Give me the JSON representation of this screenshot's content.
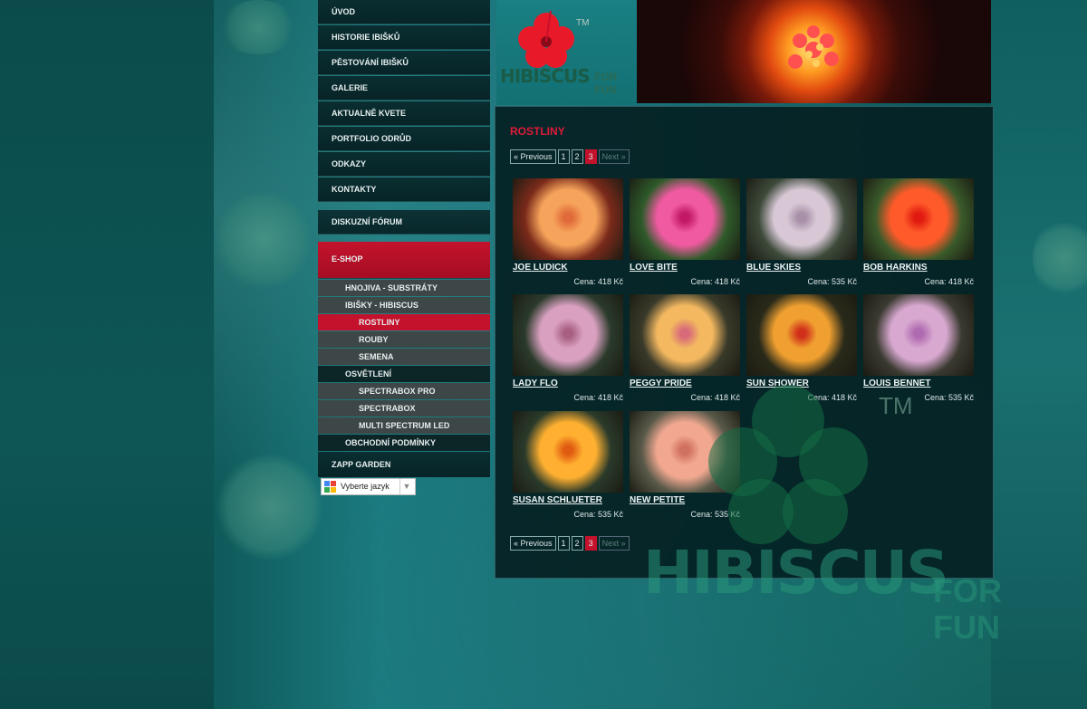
{
  "nav": {
    "items": [
      "ÚVOD",
      "HISTORIE IBIŠKŮ",
      "PĚSTOVÁNÍ IBIŠKŮ",
      "GALERIE",
      "AKTUALNĚ KVETE",
      "PORTFOLIO ODRŮD",
      "ODKAZY",
      "KONTAKTY"
    ],
    "forum": "DISKUZNÍ FÓRUM",
    "eshop": "E-SHOP",
    "sub": [
      {
        "label": "HNOJIVA - SUBSTRÁTY",
        "level": 1,
        "style": "grey"
      },
      {
        "label": "IBIŠKY - HIBISCUS",
        "level": 1,
        "style": "grey"
      },
      {
        "label": "ROSTLINY",
        "level": 2,
        "style": "active"
      },
      {
        "label": "ROUBY",
        "level": 2,
        "style": "grey"
      },
      {
        "label": "SEMENA",
        "level": 2,
        "style": "grey"
      },
      {
        "label": "OSVĚTLENÍ",
        "level": 1,
        "style": "dark"
      },
      {
        "label": "SPECTRABOX PRO",
        "level": 2,
        "style": "grey"
      },
      {
        "label": "SPECTRABOX",
        "level": 2,
        "style": "grey"
      },
      {
        "label": "MULTI SPECTRUM LED",
        "level": 2,
        "style": "grey"
      },
      {
        "label": "OBCHODNÍ PODMÍNKY",
        "level": 1,
        "style": "dark"
      }
    ],
    "zapp": "ZAPP GARDEN"
  },
  "lang": {
    "label": "Vyberte jazyk",
    "arrow": "▼"
  },
  "header": {
    "logo_main": "HIBISCUS",
    "logo_for": "FOR",
    "logo_fun": "FUN",
    "tm": "TM"
  },
  "page_title": "ROSTLINY",
  "pager": {
    "prev": "« Previous",
    "pages": [
      "1",
      "2",
      "3"
    ],
    "current": "3",
    "next": "Next »"
  },
  "products": [
    {
      "name": "JOE LUDICK",
      "price": "Cena: 418 Kč",
      "colors": [
        "#f6a35b",
        "#e06a3a",
        "#7a2a1a"
      ]
    },
    {
      "name": "LOVE BITE",
      "price": "Cena: 418 Kč",
      "colors": [
        "#f05aa0",
        "#c21865",
        "#2e5a2a"
      ]
    },
    {
      "name": "BLUE SKIES",
      "price": "Cena: 535 Kč",
      "colors": [
        "#d8c8d6",
        "#a890a8",
        "#3d4a3a"
      ]
    },
    {
      "name": "BOB HARKINS",
      "price": "Cena: 418 Kč",
      "colors": [
        "#ff5a2a",
        "#e01a10",
        "#3a5a2a"
      ]
    },
    {
      "name": "LADY FLO",
      "price": "Cena: 418 Kč",
      "colors": [
        "#d9a0c0",
        "#a86080",
        "#2a3a2a"
      ]
    },
    {
      "name": "PEGGY PRIDE",
      "price": "Cena: 418 Kč",
      "colors": [
        "#f3b860",
        "#d86a7a",
        "#3a3a2a"
      ]
    },
    {
      "name": "SUN SHOWER",
      "price": "Cena: 418 Kč",
      "colors": [
        "#f0a030",
        "#d0301a",
        "#2a2a1a"
      ]
    },
    {
      "name": "LOUIS BENNET",
      "price": "Cena: 535 Kč",
      "colors": [
        "#d8a8d0",
        "#b06ab0",
        "#3a3a30"
      ]
    },
    {
      "name": "SUSAN SCHLUETER",
      "price": "Cena: 535 Kč",
      "colors": [
        "#ffb030",
        "#e05a10",
        "#2a3a2a"
      ]
    },
    {
      "name": "NEW PETITE",
      "price": "Cena: 535 Kč",
      "colors": [
        "#f2a890",
        "#d07060",
        "#5a5a4a"
      ]
    }
  ],
  "watermark": {
    "main": "HIBISCUS",
    "for": "FOR",
    "fun": "FUN",
    "tm": "TM"
  },
  "colors": {
    "accent": "#c4122c",
    "title": "#e01a38"
  }
}
